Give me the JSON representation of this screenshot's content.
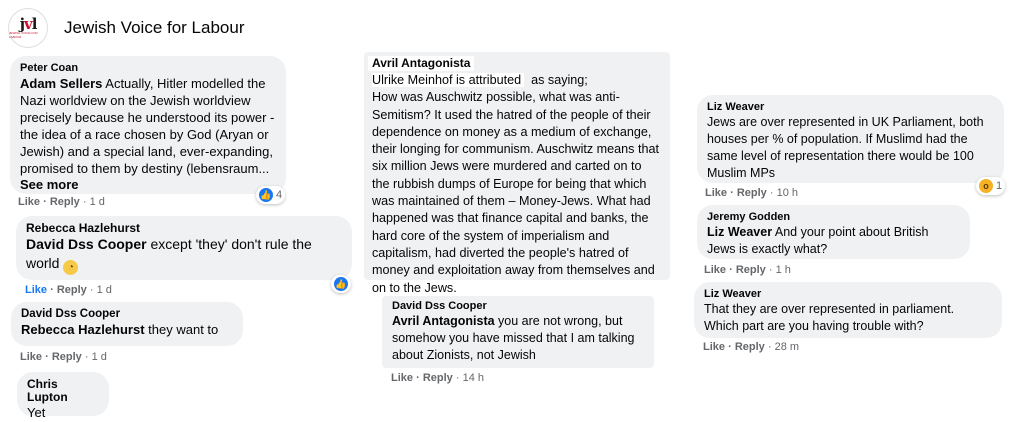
{
  "header": {
    "logo_text": "jvl",
    "logo_subtext": "JEWISH VOICE FOR LABOUR",
    "page_name": "Jewish Voice for Labour"
  },
  "actions": {
    "like": "Like",
    "reply": "Reply",
    "sep": "·"
  },
  "comments": [
    {
      "author": "Peter Coan",
      "mention": "Adam Sellers",
      "text": " Actually, Hitler modelled the Nazi worldview on the Jewish worldview precisely because he understood its power - the idea of a race chosen by God (Aryan or Jewish) and a special land, ever-expanding, promised to them by destiny (lebensraum...",
      "see_more": "See more",
      "time": "1 d",
      "reaction_count": "4"
    },
    {
      "author": "Rebecca Hazlehurst",
      "mention": "David Dss Cooper",
      "text": " except 'they' don't rule the world ",
      "emoji_name": "rolling-eyes-emoji",
      "time": "1 d"
    },
    {
      "author": "David Dss Cooper",
      "mention": "Rebecca Hazlehurst",
      "text": " they want to",
      "time": "1 d"
    },
    {
      "author": "Chris Lupton",
      "text": "Yet"
    },
    {
      "author": "Avril Antagonista",
      "text_a": "Ulrike Meinhof is attributed",
      "text_b": "as saying;",
      "text": "How was Auschwitz possible, what was anti-Semitism? It used the hatred of the people of their dependence on money as a medium of exchange, their longing for communism. Auschwitz means that six million Jews were murdered and carted on to the rubbish dumps of Europe for being that which was maintained of them – Money-Jews. What had happened was that finance capital and banks, the hard core of the system of imperialism and capitalism, had diverted the people's hatred of money and exploitation away from themselves and on to the Jews."
    },
    {
      "author": "David Dss Cooper",
      "mention": "Avril Antagonista",
      "text": " you are not wrong, but somehow you have missed that I am talking about Zionists, not Jewish",
      "time": "14 h"
    },
    {
      "author": "Liz Weaver",
      "text": "Jews are over represented in UK Parliament, both houses per % of population. If Muslimd had the same level of representation there would be 100 Muslim MPs",
      "time": "10 h",
      "reaction_count": "1"
    },
    {
      "author": "Jeremy Godden",
      "mention": "Liz Weaver",
      "text": " And your point about British Jews is exactly what?",
      "time": "1 h"
    },
    {
      "author": "Liz Weaver",
      "text": "That they are over represented in parliament. Which part are you having trouble with?",
      "time": "28 m"
    }
  ]
}
